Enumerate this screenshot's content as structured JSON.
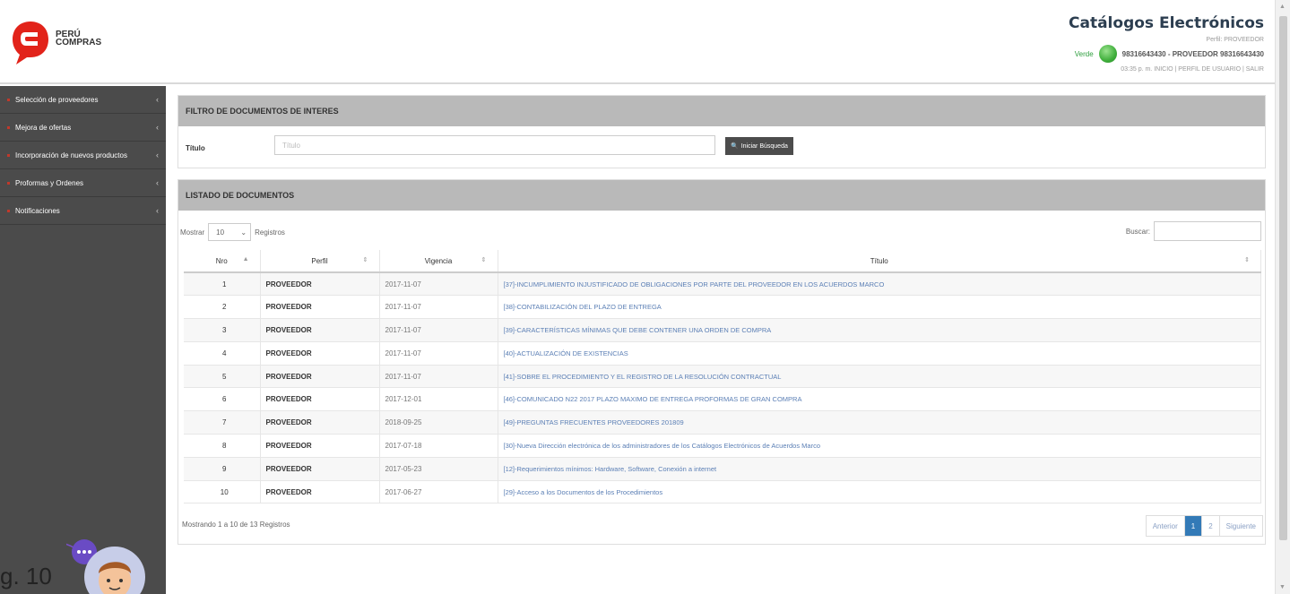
{
  "header": {
    "logo_line1": "PERÚ",
    "logo_line2": "COMPRAS",
    "title": "Catálogos Electrónicos",
    "perfil": "Perfil: PROVEEDOR",
    "status_label": "Verde",
    "user": "98316643430 - PROVEEDOR 98316643430",
    "links": "03:35 p. m. INICIO | PERFIL DE USUARIO | SALIR"
  },
  "sidebar": {
    "items": [
      {
        "label": "Selección de proveedores"
      },
      {
        "label": "Mejora de ofertas"
      },
      {
        "label": "Incorporación de nuevos productos"
      },
      {
        "label": "Proformas y Ordenes"
      },
      {
        "label": "Notificaciones"
      }
    ]
  },
  "filter": {
    "heading": "FILTRO DE DOCUMENTOS DE INTERES",
    "label": "Título",
    "placeholder": "Título",
    "button": "Iniciar Búsqueda"
  },
  "list": {
    "heading": "LISTADO DE DOCUMENTOS",
    "show_label": "Mostrar",
    "show_value": "10",
    "records_label": "Registros",
    "search_label": "Buscar:",
    "columns": {
      "nro": "Nro",
      "perfil": "Perfil",
      "vigencia": "Vigencia",
      "titulo": "Título"
    },
    "rows": [
      {
        "nro": "1",
        "perfil": "PROVEEDOR",
        "vigencia": "2017-11-07",
        "titulo": "[37]-INCUMPLIMIENTO INJUSTIFICADO DE OBLIGACIONES POR PARTE DEL PROVEEDOR EN LOS ACUERDOS MARCO"
      },
      {
        "nro": "2",
        "perfil": "PROVEEDOR",
        "vigencia": "2017-11-07",
        "titulo": "[38]-CONTABILIZACIÓN DEL PLAZO DE ENTREGA"
      },
      {
        "nro": "3",
        "perfil": "PROVEEDOR",
        "vigencia": "2017-11-07",
        "titulo": "[39]-CARACTERÍSTICAS MÍNIMAS QUE DEBE CONTENER UNA ORDEN DE COMPRA"
      },
      {
        "nro": "4",
        "perfil": "PROVEEDOR",
        "vigencia": "2017-11-07",
        "titulo": "[40]-ACTUALIZACIÓN DE EXISTENCIAS"
      },
      {
        "nro": "5",
        "perfil": "PROVEEDOR",
        "vigencia": "2017-11-07",
        "titulo": "[41]-SOBRE EL PROCEDIMIENTO Y EL REGISTRO DE LA RESOLUCIÓN CONTRACTUAL"
      },
      {
        "nro": "6",
        "perfil": "PROVEEDOR",
        "vigencia": "2017-12-01",
        "titulo": "[46]-COMUNICADO N22 2017 PLAZO MAXIMO DE ENTREGA PROFORMAS DE GRAN COMPRA"
      },
      {
        "nro": "7",
        "perfil": "PROVEEDOR",
        "vigencia": "2018-09-25",
        "titulo": "[49]-PREGUNTAS FRECUENTES PROVEEDORES 201809"
      },
      {
        "nro": "8",
        "perfil": "PROVEEDOR",
        "vigencia": "2017-07-18",
        "titulo": "[30]-Nueva Dirección electrónica de los administradores de los Catálogos Electrónicos de Acuerdos Marco"
      },
      {
        "nro": "9",
        "perfil": "PROVEEDOR",
        "vigencia": "2017-05-23",
        "titulo": "[12]-Requerimientos mínimos: Hardware, Software, Conexión a internet"
      },
      {
        "nro": "10",
        "perfil": "PROVEEDOR",
        "vigencia": "2017-06-27",
        "titulo": "[29]-Acceso a los Documentos de los Procedimientos"
      }
    ],
    "footer_info": "Mostrando 1 a 10 de 13 Registros",
    "pager": {
      "prev": "Anterior",
      "page1": "1",
      "page2": "2",
      "next": "Siguiente"
    }
  },
  "overlay": {
    "caption": "g. 10"
  },
  "colors": {
    "brand_red": "#e2231a",
    "sidebar_bg": "#4b4b4b",
    "panel_head": "#b9b9b9",
    "link_blue": "#5b7fb5",
    "status_green": "#3fae3b",
    "pager_active": "#337ab7"
  }
}
